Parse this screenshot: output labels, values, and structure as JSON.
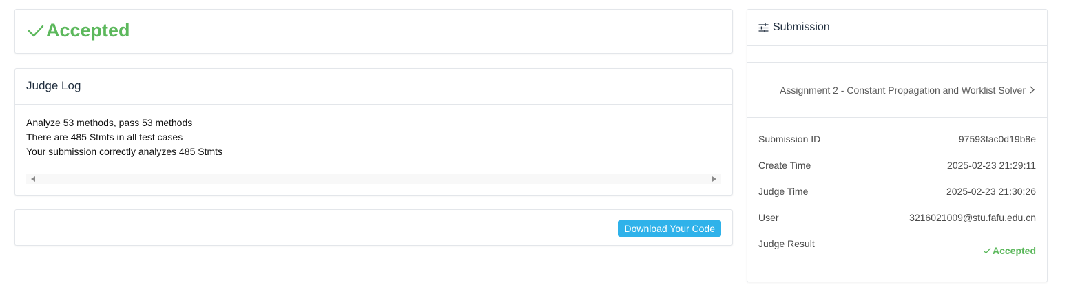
{
  "status": {
    "label": "Accepted",
    "color": "#5cb85c",
    "icon": "check-icon"
  },
  "judge_log": {
    "title": "Judge Log",
    "lines": [
      "Analyze 53 methods, pass 53 methods",
      "There are 485 Stmts in all test cases",
      "Your submission correctly analyzes 485 Stmts"
    ]
  },
  "download": {
    "label": "Download Your Code",
    "color": "#2fb2ea"
  },
  "submission": {
    "title": "Submission",
    "title_icon": "sliders-icon",
    "assignment": "Assignment 2 - Constant Propagation and Worklist Solver",
    "assignment_icon": "chevron-right-icon",
    "details": [
      {
        "key": "Submission ID",
        "value": "97593fac0d19b8e"
      },
      {
        "key": "Create Time",
        "value": "2025-02-23 21:29:11"
      },
      {
        "key": "Judge Time",
        "value": "2025-02-23 21:30:26"
      },
      {
        "key": "User",
        "value": "3216021009@stu.fafu.edu.cn"
      },
      {
        "key": "Judge Result",
        "value": "Accepted"
      }
    ]
  }
}
